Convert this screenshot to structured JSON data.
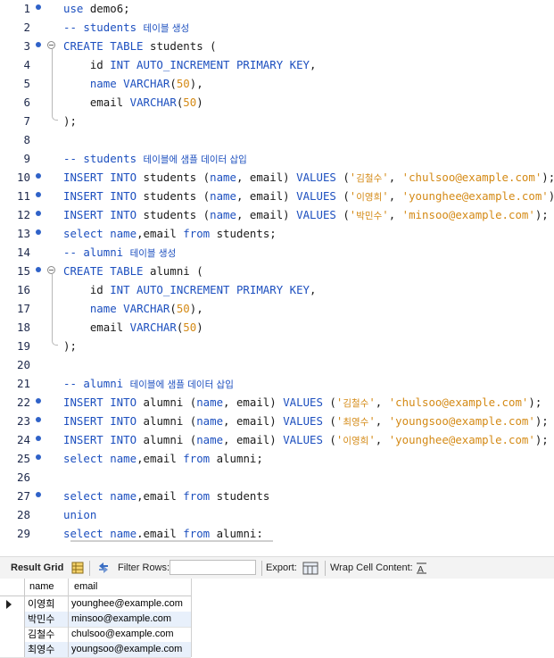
{
  "editor": {
    "lines": [
      {
        "n": "1",
        "dot": true,
        "tokens": [
          {
            "t": "kw",
            "v": "use"
          },
          {
            "t": "tx",
            "v": " demo6;"
          }
        ]
      },
      {
        "n": "2",
        "tokens": [
          {
            "t": "cm",
            "v": "-- students "
          },
          {
            "t": "kr",
            "v": "테이블 생성"
          }
        ]
      },
      {
        "n": "3",
        "dot": true,
        "fold": "open",
        "tokens": [
          {
            "t": "kw",
            "v": "CREATE TABLE"
          },
          {
            "t": "tx",
            "v": " students ("
          }
        ]
      },
      {
        "n": "4",
        "fold": "mid",
        "tokens": [
          {
            "t": "tx",
            "v": "    id "
          },
          {
            "t": "kw",
            "v": "INT AUTO_INCREMENT PRIMARY KEY"
          },
          {
            "t": "tx",
            "v": ","
          }
        ]
      },
      {
        "n": "5",
        "fold": "mid",
        "tokens": [
          {
            "t": "tx",
            "v": "    "
          },
          {
            "t": "kw",
            "v": "name"
          },
          {
            "t": "tx",
            "v": " "
          },
          {
            "t": "kw",
            "v": "VARCHAR"
          },
          {
            "t": "tx",
            "v": "("
          },
          {
            "t": "num",
            "v": "50"
          },
          {
            "t": "tx",
            "v": "),"
          }
        ]
      },
      {
        "n": "6",
        "fold": "mid",
        "tokens": [
          {
            "t": "tx",
            "v": "    email "
          },
          {
            "t": "kw",
            "v": "VARCHAR"
          },
          {
            "t": "tx",
            "v": "("
          },
          {
            "t": "num",
            "v": "50"
          },
          {
            "t": "tx",
            "v": ")"
          }
        ]
      },
      {
        "n": "7",
        "fold": "end",
        "tokens": [
          {
            "t": "tx",
            "v": ");"
          }
        ]
      },
      {
        "n": "8",
        "tokens": []
      },
      {
        "n": "9",
        "tokens": [
          {
            "t": "cm",
            "v": "-- students "
          },
          {
            "t": "kr",
            "v": "테이블에 샘플 데이터 삽입"
          }
        ]
      },
      {
        "n": "10",
        "dot": true,
        "tokens": [
          {
            "t": "kw",
            "v": "INSERT INTO"
          },
          {
            "t": "tx",
            "v": " students ("
          },
          {
            "t": "kw",
            "v": "name"
          },
          {
            "t": "tx",
            "v": ", email) "
          },
          {
            "t": "kw",
            "v": "VALUES"
          },
          {
            "t": "tx",
            "v": " ("
          },
          {
            "t": "str",
            "v": "'"
          },
          {
            "t": "krs",
            "v": "김철수"
          },
          {
            "t": "str",
            "v": "'"
          },
          {
            "t": "tx",
            "v": ", "
          },
          {
            "t": "str",
            "v": "'chulsoo@example.com'"
          },
          {
            "t": "tx",
            "v": ");"
          }
        ]
      },
      {
        "n": "11",
        "dot": true,
        "tokens": [
          {
            "t": "kw",
            "v": "INSERT INTO"
          },
          {
            "t": "tx",
            "v": " students ("
          },
          {
            "t": "kw",
            "v": "name"
          },
          {
            "t": "tx",
            "v": ", email) "
          },
          {
            "t": "kw",
            "v": "VALUES"
          },
          {
            "t": "tx",
            "v": " ("
          },
          {
            "t": "str",
            "v": "'"
          },
          {
            "t": "krs",
            "v": "이영희"
          },
          {
            "t": "str",
            "v": "'"
          },
          {
            "t": "tx",
            "v": ", "
          },
          {
            "t": "str",
            "v": "'younghee@example.com'"
          },
          {
            "t": "tx",
            "v": ");"
          }
        ]
      },
      {
        "n": "12",
        "dot": true,
        "tokens": [
          {
            "t": "kw",
            "v": "INSERT INTO"
          },
          {
            "t": "tx",
            "v": " students ("
          },
          {
            "t": "kw",
            "v": "name"
          },
          {
            "t": "tx",
            "v": ", email) "
          },
          {
            "t": "kw",
            "v": "VALUES"
          },
          {
            "t": "tx",
            "v": " ("
          },
          {
            "t": "str",
            "v": "'"
          },
          {
            "t": "krs",
            "v": "박민수"
          },
          {
            "t": "str",
            "v": "'"
          },
          {
            "t": "tx",
            "v": ", "
          },
          {
            "t": "str",
            "v": "'minsoo@example.com'"
          },
          {
            "t": "tx",
            "v": ");"
          }
        ]
      },
      {
        "n": "13",
        "dot": true,
        "tokens": [
          {
            "t": "kw",
            "v": "select"
          },
          {
            "t": "tx",
            "v": " "
          },
          {
            "t": "kw",
            "v": "name"
          },
          {
            "t": "tx",
            "v": ",email "
          },
          {
            "t": "kw",
            "v": "from"
          },
          {
            "t": "tx",
            "v": " students;"
          }
        ]
      },
      {
        "n": "14",
        "tokens": [
          {
            "t": "cm",
            "v": "-- alumni "
          },
          {
            "t": "kr",
            "v": "테이블 생성"
          }
        ]
      },
      {
        "n": "15",
        "dot": true,
        "fold": "open",
        "tokens": [
          {
            "t": "kw",
            "v": "CREATE TABLE"
          },
          {
            "t": "tx",
            "v": " alumni ("
          }
        ]
      },
      {
        "n": "16",
        "fold": "mid",
        "tokens": [
          {
            "t": "tx",
            "v": "    id "
          },
          {
            "t": "kw",
            "v": "INT AUTO_INCREMENT PRIMARY KEY"
          },
          {
            "t": "tx",
            "v": ","
          }
        ]
      },
      {
        "n": "17",
        "fold": "mid",
        "tokens": [
          {
            "t": "tx",
            "v": "    "
          },
          {
            "t": "kw",
            "v": "name"
          },
          {
            "t": "tx",
            "v": " "
          },
          {
            "t": "kw",
            "v": "VARCHAR"
          },
          {
            "t": "tx",
            "v": "("
          },
          {
            "t": "num",
            "v": "50"
          },
          {
            "t": "tx",
            "v": "),"
          }
        ]
      },
      {
        "n": "18",
        "fold": "mid",
        "tokens": [
          {
            "t": "tx",
            "v": "    email "
          },
          {
            "t": "kw",
            "v": "VARCHAR"
          },
          {
            "t": "tx",
            "v": "("
          },
          {
            "t": "num",
            "v": "50"
          },
          {
            "t": "tx",
            "v": ")"
          }
        ]
      },
      {
        "n": "19",
        "fold": "end",
        "tokens": [
          {
            "t": "tx",
            "v": ");"
          }
        ]
      },
      {
        "n": "20",
        "tokens": []
      },
      {
        "n": "21",
        "tokens": [
          {
            "t": "cm",
            "v": "-- alumni "
          },
          {
            "t": "kr",
            "v": "테이블에 샘플 데이터 삽입"
          }
        ]
      },
      {
        "n": "22",
        "dot": true,
        "tokens": [
          {
            "t": "kw",
            "v": "INSERT INTO"
          },
          {
            "t": "tx",
            "v": " alumni ("
          },
          {
            "t": "kw",
            "v": "name"
          },
          {
            "t": "tx",
            "v": ", email) "
          },
          {
            "t": "kw",
            "v": "VALUES"
          },
          {
            "t": "tx",
            "v": " ("
          },
          {
            "t": "str",
            "v": "'"
          },
          {
            "t": "krs",
            "v": "김철수"
          },
          {
            "t": "str",
            "v": "'"
          },
          {
            "t": "tx",
            "v": ", "
          },
          {
            "t": "str",
            "v": "'chulsoo@example.com'"
          },
          {
            "t": "tx",
            "v": ");"
          }
        ]
      },
      {
        "n": "23",
        "dot": true,
        "tokens": [
          {
            "t": "kw",
            "v": "INSERT INTO"
          },
          {
            "t": "tx",
            "v": " alumni ("
          },
          {
            "t": "kw",
            "v": "name"
          },
          {
            "t": "tx",
            "v": ", email) "
          },
          {
            "t": "kw",
            "v": "VALUES"
          },
          {
            "t": "tx",
            "v": " ("
          },
          {
            "t": "str",
            "v": "'"
          },
          {
            "t": "krs",
            "v": "최영수"
          },
          {
            "t": "str",
            "v": "'"
          },
          {
            "t": "tx",
            "v": ", "
          },
          {
            "t": "str",
            "v": "'youngsoo@example.com'"
          },
          {
            "t": "tx",
            "v": ");"
          }
        ]
      },
      {
        "n": "24",
        "dot": true,
        "tokens": [
          {
            "t": "kw",
            "v": "INSERT INTO"
          },
          {
            "t": "tx",
            "v": " alumni ("
          },
          {
            "t": "kw",
            "v": "name"
          },
          {
            "t": "tx",
            "v": ", email) "
          },
          {
            "t": "kw",
            "v": "VALUES"
          },
          {
            "t": "tx",
            "v": " ("
          },
          {
            "t": "str",
            "v": "'"
          },
          {
            "t": "krs",
            "v": "이영희"
          },
          {
            "t": "str",
            "v": "'"
          },
          {
            "t": "tx",
            "v": ", "
          },
          {
            "t": "str",
            "v": "'younghee@example.com'"
          },
          {
            "t": "tx",
            "v": ");"
          }
        ]
      },
      {
        "n": "25",
        "dot": true,
        "tokens": [
          {
            "t": "kw",
            "v": "select"
          },
          {
            "t": "tx",
            "v": " "
          },
          {
            "t": "kw",
            "v": "name"
          },
          {
            "t": "tx",
            "v": ",email "
          },
          {
            "t": "kw",
            "v": "from"
          },
          {
            "t": "tx",
            "v": " alumni;"
          }
        ]
      },
      {
        "n": "26",
        "tokens": []
      },
      {
        "n": "27",
        "dot": true,
        "tokens": [
          {
            "t": "kw",
            "v": "select"
          },
          {
            "t": "tx",
            "v": " "
          },
          {
            "t": "kw",
            "v": "name"
          },
          {
            "t": "tx",
            "v": ",email "
          },
          {
            "t": "kw",
            "v": "from"
          },
          {
            "t": "tx",
            "v": " students"
          }
        ]
      },
      {
        "n": "28",
        "tokens": [
          {
            "t": "kw",
            "v": "union"
          }
        ]
      },
      {
        "n": "29",
        "tokens": [
          {
            "t": "kw",
            "v": "select"
          },
          {
            "t": "tx",
            "v": " "
          },
          {
            "t": "kw",
            "v": "name"
          },
          {
            "t": "tx",
            "v": ",email "
          },
          {
            "t": "kw",
            "v": "from"
          },
          {
            "t": "tx",
            "v": " alumni;"
          }
        ]
      }
    ]
  },
  "toolbar": {
    "result_grid_label": "Result Grid",
    "filter_rows_label": "Filter Rows:",
    "filter_value": "",
    "export_label": "Export:",
    "wrap_label": "Wrap Cell Content:",
    "icons": [
      "grid-view-icon",
      "refresh-icon",
      "export-icon",
      "wrap-icon"
    ]
  },
  "grid": {
    "columns": [
      "name",
      "email"
    ],
    "rows": [
      {
        "name": "이영희",
        "email": "younghee@example.com",
        "current": true
      },
      {
        "name": "박민수",
        "email": "minsoo@example.com"
      },
      {
        "name": "김철수",
        "email": "chulsoo@example.com"
      },
      {
        "name": "최영수",
        "email": "youngsoo@example.com"
      }
    ]
  },
  "colors": {
    "keyword": "#1c4fbf",
    "string": "#d48a16",
    "breakpoint_dot": "#2f62c8",
    "alt_row": "#e8f0fb"
  }
}
